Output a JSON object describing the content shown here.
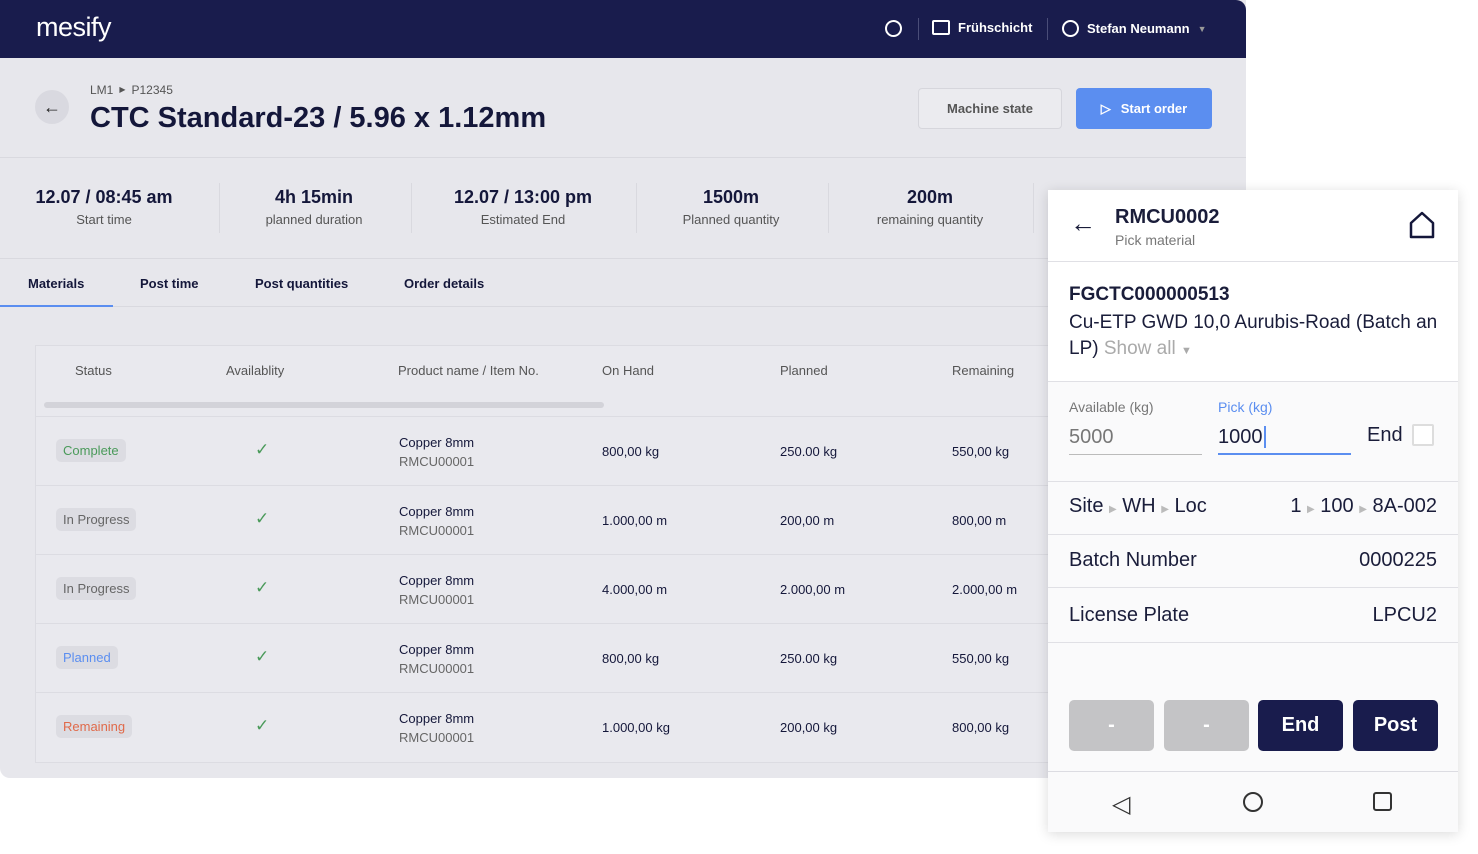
{
  "header": {
    "logo": "mesify",
    "shift": "Frühschicht",
    "user": "Stefan Neumann"
  },
  "breadcrumb": [
    "LM1",
    "P12345"
  ],
  "title": "CTC Standard-23 / 5.96 x 1.12mm",
  "buttons": {
    "machine_state": "Machine state",
    "start_order": "Start order"
  },
  "stats": [
    {
      "value": "12.07 / 08:45 am",
      "label": "Start time"
    },
    {
      "value": "4h 15min",
      "label": "planned duration"
    },
    {
      "value": "12.07 / 13:00 pm",
      "label": "Estimated End"
    },
    {
      "value": "1500m",
      "label": "Planned quantity"
    },
    {
      "value": "200m",
      "label": "remaining quantity"
    }
  ],
  "tabs": [
    "Materials",
    "Post time",
    "Post quantities",
    "Order details"
  ],
  "table": {
    "columns": [
      "Status",
      "Availablity",
      "Product name / Item No.",
      "On Hand",
      "Planned",
      "Remaining"
    ],
    "rows": [
      {
        "status": "Complete",
        "status_color": "#4a9a5a",
        "product": "Copper 8mm",
        "item": "RMCU00001",
        "on_hand": "800,00 kg",
        "planned": "250.00 kg",
        "remaining": "550,00 kg"
      },
      {
        "status": "In Progress",
        "status_color": "#666666",
        "product": "Copper 8mm",
        "item": "RMCU00001",
        "on_hand": "1.000,00 m",
        "planned": "200,00 m",
        "remaining": "800,00 m"
      },
      {
        "status": "In Progress",
        "status_color": "#666666",
        "product": "Copper 8mm",
        "item": "RMCU00001",
        "on_hand": "4.000,00 m",
        "planned": "2.000,00 m",
        "remaining": "2.000,00 m"
      },
      {
        "status": "Planned",
        "status_color": "#5b8ef0",
        "product": "Copper 8mm",
        "item": "RMCU00001",
        "on_hand": "800,00 kg",
        "planned": "250.00 kg",
        "remaining": "550,00 kg"
      },
      {
        "status": "Remaining",
        "status_color": "#e06a4a",
        "product": "Copper 8mm",
        "item": "RMCU00001",
        "on_hand": "1.000,00 kg",
        "planned": "200,00 kg",
        "remaining": "800,00 kg"
      }
    ]
  },
  "phone": {
    "title": "RMCU0002",
    "subtitle": "Pick material",
    "code": "FGCTC000000513",
    "description": "Cu-ETP GWD 10,0 Aurubis-Road (Batch an LP)",
    "show_all": "Show all",
    "available_label": "Available (kg)",
    "available_value": "5000",
    "pick_label": "Pick (kg)",
    "pick_value": "1000",
    "end_label": "End",
    "location_labels": [
      "Site",
      "WH",
      "Loc"
    ],
    "location_values": [
      "1",
      "100",
      "8A-002"
    ],
    "batch_label": "Batch Number",
    "batch_value": "0000225",
    "plate_label": "License Plate",
    "plate_value": "LPCU2",
    "buttons": [
      "-",
      "-",
      "End",
      "Post"
    ]
  }
}
